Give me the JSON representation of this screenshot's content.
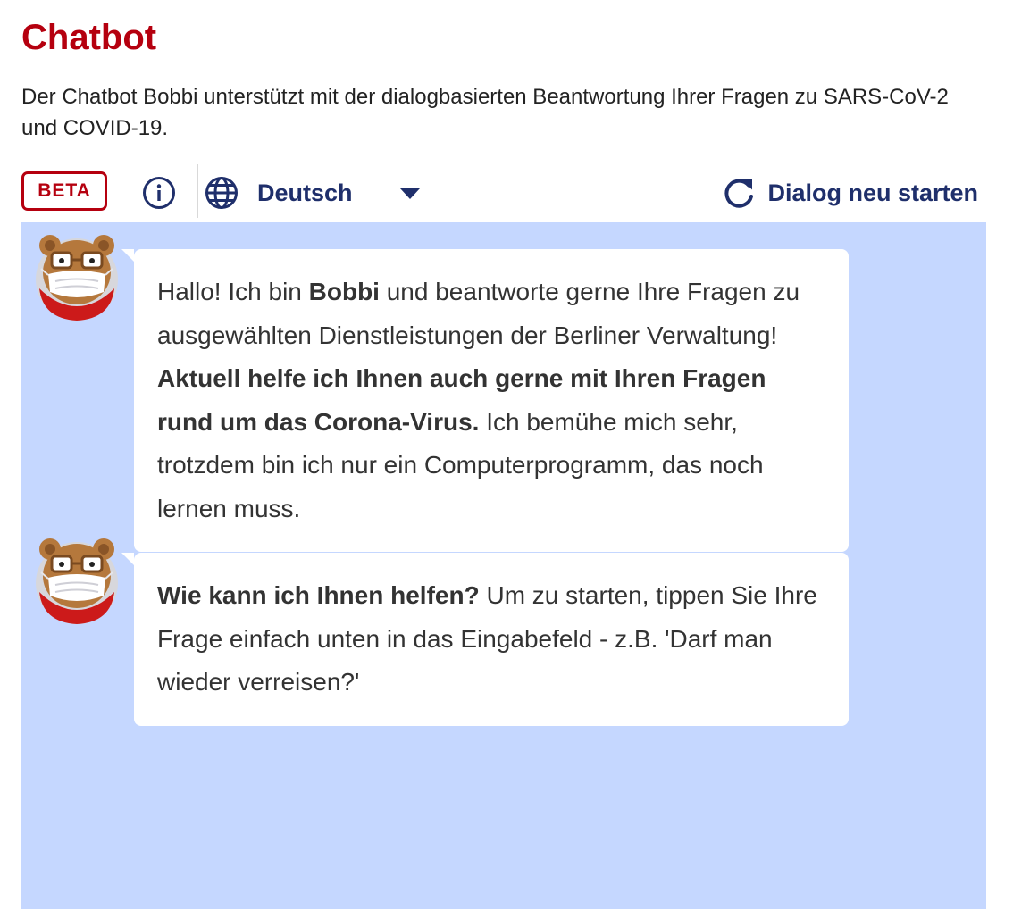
{
  "page": {
    "title": "Chatbot",
    "intro": "Der Chatbot Bobbi unterstützt mit der dialogbasierten Beantwortung Ihrer Fragen zu SARS-CoV-2 und COVID-19."
  },
  "toolbar": {
    "beta_label": "BETA",
    "info_icon": "info-icon",
    "language_icon": "globe-icon",
    "language": "Deutsch",
    "restart_icon": "refresh-icon",
    "restart_label": "Dialog neu starten"
  },
  "colors": {
    "brand_red": "#b5000f",
    "navy": "#1f2f6b",
    "chat_background": "#c5d7ff",
    "bubble_background": "#ffffff"
  },
  "messages": [
    {
      "sender": "Bobbi",
      "avatar_icon": "bear-with-mask-avatar",
      "segments": [
        {
          "text": "Hallo! Ich bin ",
          "bold": false
        },
        {
          "text": "Bobbi",
          "bold": true
        },
        {
          "text": " und beantworte gerne Ihre Fragen zu ausgewählten Dienstleistungen der Berliner Verwaltung! ",
          "bold": false
        },
        {
          "text": "Aktuell helfe ich Ihnen auch gerne mit Ihren Fragen rund um das Corona-Virus.",
          "bold": true
        },
        {
          "text": " Ich bemühe mich sehr, trotzdem bin ich nur ein Computerprogramm, das noch lernen muss.",
          "bold": false
        }
      ]
    },
    {
      "sender": "Bobbi",
      "avatar_icon": "bear-with-mask-avatar",
      "segments": [
        {
          "text": "Wie kann ich Ihnen helfen?",
          "bold": true
        },
        {
          "text": " Um zu starten, tippen Sie Ihre Frage einfach unten in das Eingabefeld - z.B. 'Darf man wieder verreisen?'",
          "bold": false
        }
      ]
    }
  ]
}
